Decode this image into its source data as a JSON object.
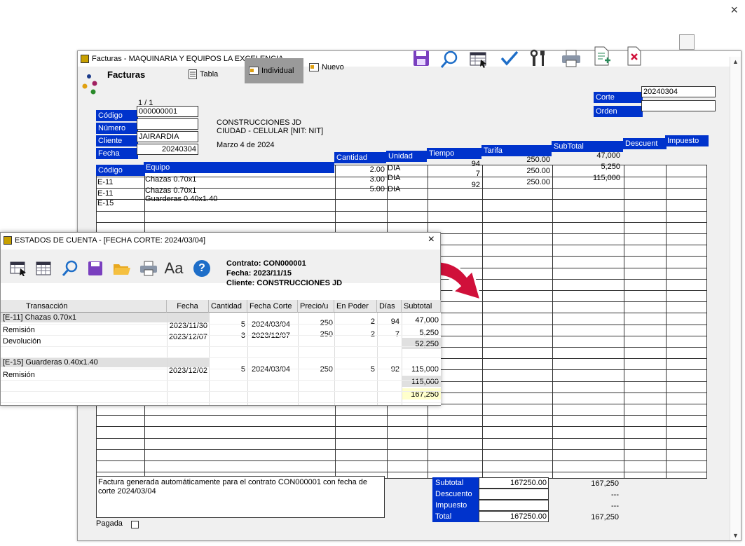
{
  "outer_close": "×",
  "main": {
    "title": "Facturas - MAQUINARIA Y EQUIPOS LA EXCELENCIA",
    "section_title": "Facturas",
    "tabs": [
      {
        "label": "Tabla"
      },
      {
        "label": "Individual"
      },
      {
        "label": "Nuevo"
      }
    ],
    "record_counter": "1 / 1",
    "fields": {
      "codigo_label": "Código",
      "codigo_value": "000000001",
      "numero_label": "Número",
      "numero_value": "",
      "cliente_label": "Cliente",
      "cliente_value": "JAIRARDIA",
      "fecha_label": "Fecha",
      "fecha_value": "20240304",
      "corte_label": "Corte",
      "corte_value": "20240304",
      "orden_label": "Orden",
      "orden_value": ""
    },
    "client_block": {
      "name": "CONSTRUCCIONES JD",
      "address": "CIUDAD - CELULAR [NIT: NIT]",
      "date_text": "Marzo 4 de 2024"
    },
    "columns": [
      "Código",
      "Equipo",
      "Cantidad",
      "Unidad",
      "Tiempo",
      "Tarifa",
      "SubTotal",
      "Descuent",
      "Impuesto"
    ],
    "rows": [
      {
        "codigo": "E-11",
        "equipo": "Chazas 0.70x1",
        "cantidad": "2.00",
        "unidad": "DIA",
        "tiempo": "94",
        "tarifa": "250.00",
        "subtotal": "47,000"
      },
      {
        "codigo": "E-11",
        "equipo": "Chazas 0.70x1",
        "cantidad": "3.00",
        "unidad": "DIA",
        "tiempo": "7",
        "tarifa": "250.00",
        "subtotal": "5,250"
      },
      {
        "codigo": "E-15",
        "equipo": "Guarderas 0.40x1.40",
        "cantidad": "5.00",
        "unidad": "DIA",
        "tiempo": "92",
        "tarifa": "250.00",
        "subtotal": "115,000"
      }
    ],
    "note": "Factura generada automáticamente para el contrato CON000001 con fecha de corte 2024/03/04",
    "pagada_label": "Pagada",
    "totals": {
      "subtotal_label": "Subtotal",
      "subtotal_value": "167250.00",
      "subtotal_fmt": "167,250",
      "descuento_label": "Descuento",
      "descuento_fmt": "---",
      "impuesto_label": "Impuesto",
      "impuesto_fmt": "---",
      "total_label": "Total",
      "total_value": "167250.00",
      "total_fmt": "167,250"
    }
  },
  "estado": {
    "title": "ESTADOS DE CUENTA - [FECHA CORTE: 2024/03/04]",
    "close": "×",
    "contrato_label": "Contrato:",
    "contrato_value": "CON000001",
    "fecha_label": "Fecha:",
    "fecha_value": "2023/11/15",
    "cliente_label": "Cliente:",
    "cliente_value": "CONSTRUCCIONES JD",
    "font_button": "Aa",
    "help_button": "?",
    "columns": [
      "Transacción",
      "Fecha",
      "Cantidad",
      "Fecha Corte",
      "Precio/u",
      "En Poder",
      "Días",
      "Subtotal"
    ],
    "groups": [
      {
        "header": "[E-11] Chazas 0.70x1",
        "rows": [
          {
            "tx": "Remisión",
            "fecha": "2023/11/30",
            "cantidad": "5",
            "corte": "2024/03/04",
            "precio": "250",
            "poder": "2",
            "dias": "94",
            "subtotal": "47,000"
          },
          {
            "tx": "Devolución",
            "fecha": "2023/12/07",
            "cantidad": "3",
            "corte": "2023/12/07",
            "precio": "250",
            "poder": "2",
            "dias": "7",
            "subtotal": "5,250"
          }
        ],
        "group_total": "52,250"
      },
      {
        "header": "[E-15] Guarderas 0.40x1.40",
        "rows": [
          {
            "tx": "Remisión",
            "fecha": "2023/12/02",
            "cantidad": "5",
            "corte": "2024/03/04",
            "precio": "250",
            "poder": "5",
            "dias": "92",
            "subtotal": "115,000"
          }
        ],
        "group_total": "115,000"
      }
    ],
    "grand_total": "167,250"
  },
  "colors": {
    "header_blue": "#0033cc",
    "arrow_red": "#d0103a",
    "save_purple": "#7a3fbf",
    "check_blue": "#1e6ec8"
  }
}
